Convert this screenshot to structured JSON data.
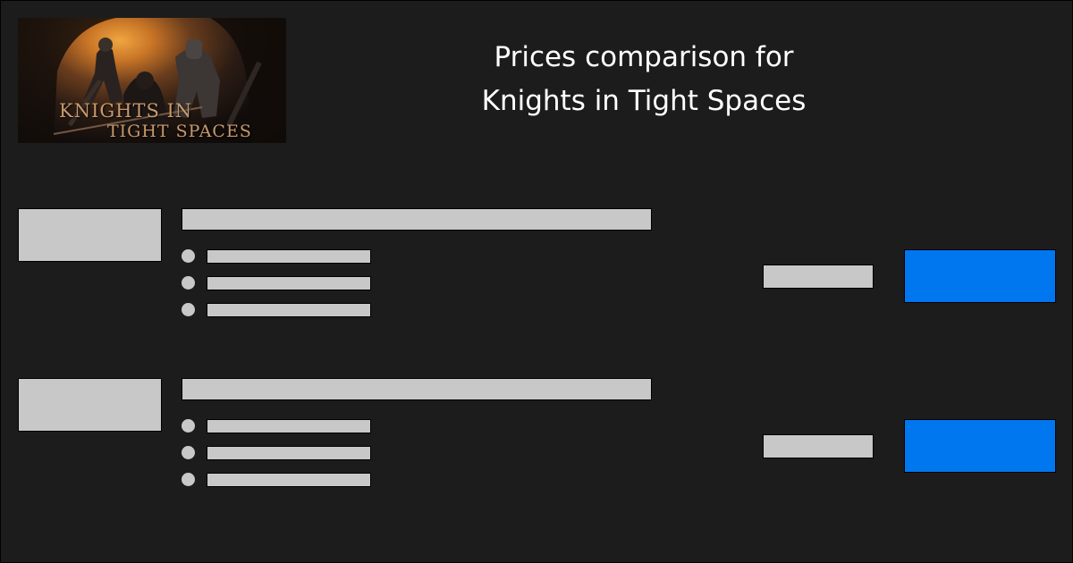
{
  "header": {
    "game_art": {
      "logo_line_1": "KNIGHTS IN",
      "logo_line_2": "TIGHT SPACES"
    },
    "title_line_1": "Prices comparison for",
    "title_line_2": "Knights in Tight Spaces"
  },
  "offers": [
    {
      "store_logo": "",
      "title": "",
      "features": [
        "",
        "",
        ""
      ],
      "price": "",
      "buy_label": ""
    },
    {
      "store_logo": "",
      "title": "",
      "features": [
        "",
        "",
        ""
      ],
      "price": "",
      "buy_label": ""
    }
  ],
  "colors": {
    "background": "#1c1c1c",
    "placeholder": "#c8c8c8",
    "button_accent": "#0077ee",
    "title_text": "#ffffff"
  }
}
